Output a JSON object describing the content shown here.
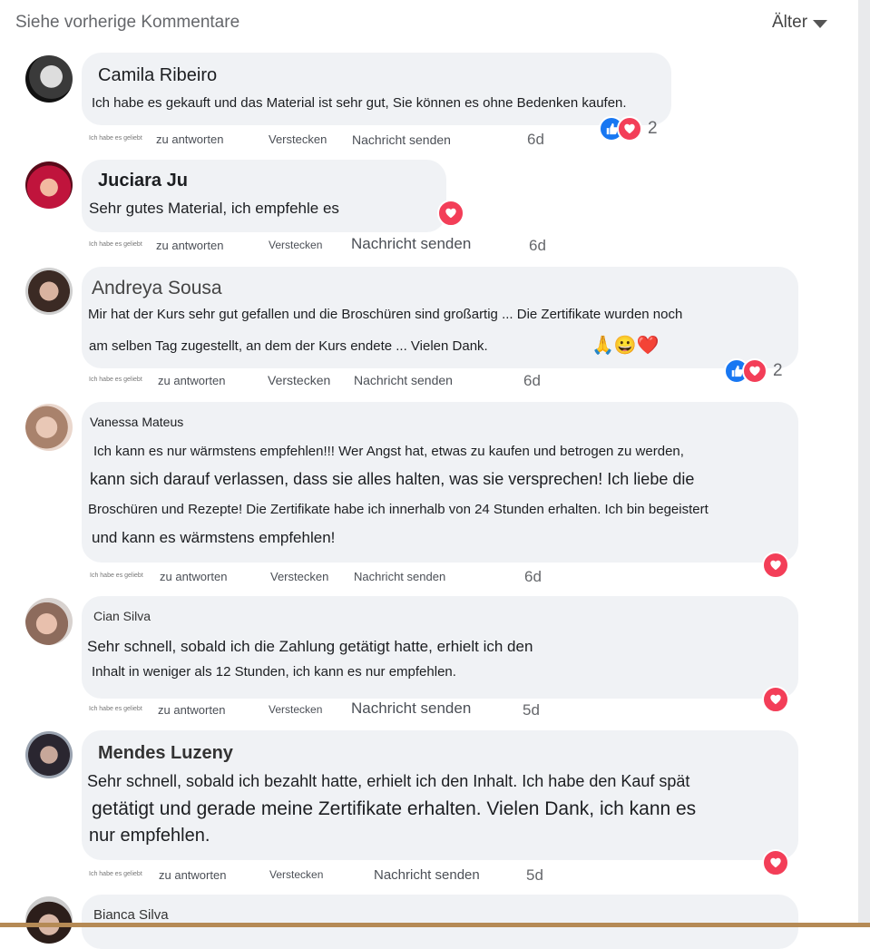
{
  "header": {
    "previous_comments": "Siehe vorherige Kommentare",
    "sort_label": "Älter"
  },
  "actions": {
    "liked": "Ich habe es geliebt",
    "reply": "zu antworten",
    "hide": "Verstecken",
    "message": "Nachricht senden"
  },
  "comments": [
    {
      "name": "Camila Ribeiro",
      "lines": [
        "Ich habe es gekauft und das Material ist sehr gut, Sie können es ohne Bedenken kaufen."
      ],
      "age": "6d",
      "reactions": [
        "like",
        "love"
      ],
      "reaction_count": "2"
    },
    {
      "name": "Juciara Ju",
      "lines": [
        "Sehr gutes Material, ich empfehle es"
      ],
      "age": "6d",
      "reactions": [
        "love"
      ]
    },
    {
      "name": "Andreya Sousa",
      "lines": [
        "Mir hat der Kurs sehr gut gefallen und die Broschüren sind großartig ... Die Zertifikate wurden noch",
        "am selben Tag zugestellt, an dem der Kurs endete ... Vielen Dank."
      ],
      "emojis": "🙏😀❤️",
      "age": "6d",
      "reactions": [
        "like",
        "love"
      ],
      "reaction_count": "2"
    },
    {
      "name": "Vanessa Mateus",
      "lines": [
        "Ich kann es nur wärmstens empfehlen!!! Wer Angst hat, etwas zu kaufen und betrogen zu werden,",
        "kann sich darauf verlassen, dass sie alles halten, was sie versprechen! Ich liebe die",
        "Broschüren und Rezepte! Die Zertifikate habe ich innerhalb von 24 Stunden erhalten. Ich bin begeistert",
        "und kann es wärmstens empfehlen!"
      ],
      "age": "6d",
      "reactions": [
        "love"
      ]
    },
    {
      "name": "Cian Silva",
      "lines": [
        "Sehr schnell, sobald ich die Zahlung getätigt hatte, erhielt ich den",
        "Inhalt in weniger als 12 Stunden, ich kann es nur empfehlen."
      ],
      "age": "5d",
      "reactions": [
        "love"
      ]
    },
    {
      "name": "Mendes Luzeny",
      "lines": [
        "Sehr schnell, sobald ich bezahlt hatte, erhielt ich den Inhalt. Ich habe den Kauf spät",
        "getätigt und gerade meine Zertifikate erhalten. Vielen Dank, ich kann es",
        "nur empfehlen."
      ],
      "age": "5d",
      "reactions": [
        "love"
      ]
    },
    {
      "name": "Bianca Silva",
      "lines": []
    }
  ],
  "colors": {
    "bubble": "#f0f2f5",
    "like": "#1877f2",
    "love": "#f33e58",
    "meta": "#65676b"
  }
}
